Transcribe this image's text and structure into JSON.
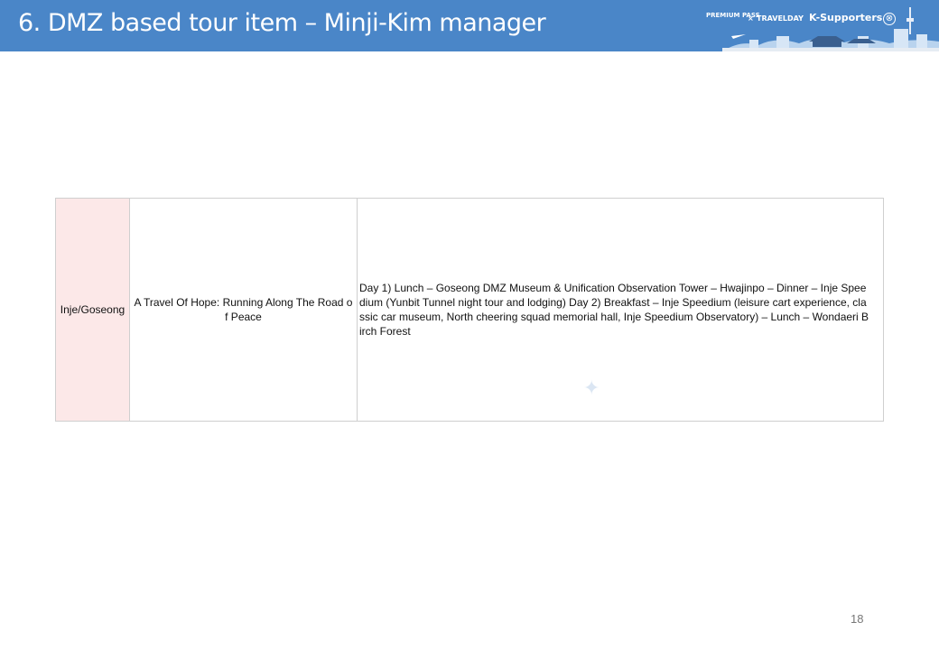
{
  "header": {
    "title": "6. DMZ based tour item – Minji-Kim manager",
    "brand": {
      "premium": "PREMIUM PASS",
      "x": "×",
      "travelday": "TRAVELDAY",
      "ksupporters": "K-Supporters"
    },
    "close_icon": "⊗"
  },
  "table": {
    "rows": [
      {
        "region": "Inje/Goseong",
        "tour_name": "A Travel Of Hope: Running Along The Road of Peace",
        "itinerary": "Day 1) Lunch – Goseong DMZ Museum & Unification Observation Tower – Hwajinpo – Dinner – Inje Speedium (Yunbit Tunnel night tour and lodging) Day 2) Breakfast – Inje Speedium (leisure cart experience, classic car museum, North cheering squad memorial hall, Inje Speedium Observatory) – Lunch – Wondaeri Birch Forest"
      }
    ]
  },
  "page_number": "18",
  "colors": {
    "header_bg": "#4a86c8",
    "region_bg": "#fce8e8",
    "border": "#cfcfcf"
  }
}
